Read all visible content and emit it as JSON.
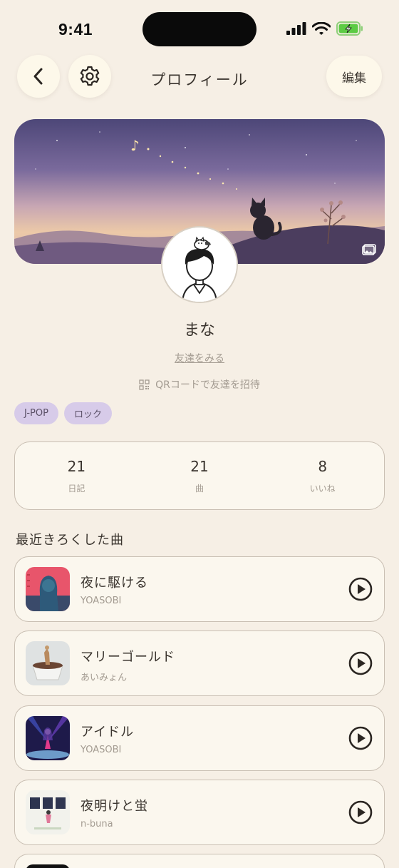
{
  "status_bar": {
    "time": "9:41"
  },
  "header": {
    "title": "プロフィール",
    "edit_label": "編集"
  },
  "profile": {
    "name": "まな",
    "friends_link": "友達をみる",
    "invite_text": "QRコードで友達を招待",
    "tags": [
      "J-POP",
      "ロック"
    ]
  },
  "stats": [
    {
      "value": "21",
      "label": "日記"
    },
    {
      "value": "21",
      "label": "曲"
    },
    {
      "value": "8",
      "label": "いいね"
    }
  ],
  "recent": {
    "title": "最近きろくした曲",
    "songs": [
      {
        "title": "夜に駆ける",
        "artist": "YOASOBI"
      },
      {
        "title": "マリーゴールド",
        "artist": "あいみょん"
      },
      {
        "title": "アイドル",
        "artist": "YOASOBI"
      },
      {
        "title": "夜明けと蛍",
        "artist": "n-buna"
      }
    ]
  },
  "colors": {
    "background": "#f6efe5",
    "card": "#fbf7ee",
    "tag": "#d7cbe9",
    "border": "#c9bfb3",
    "muted_text": "#a39b91"
  },
  "icons": [
    "back-chevron-icon",
    "gear-icon",
    "photo-icon",
    "qr-code-icon",
    "play-icon"
  ]
}
